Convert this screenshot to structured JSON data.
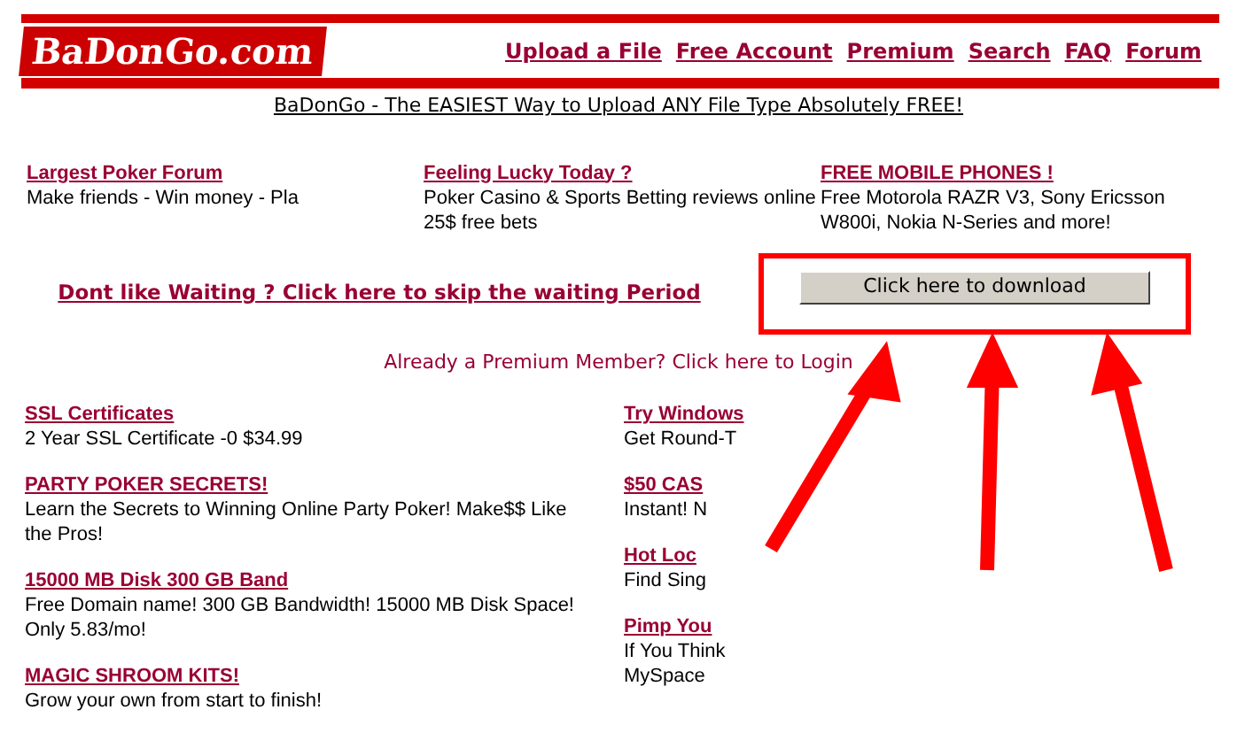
{
  "header": {
    "logo": "BaDonGo.com",
    "nav": [
      "Upload a File",
      "Free Account",
      "Premium",
      "Search",
      "FAQ",
      "Forum"
    ]
  },
  "tagline": "BaDonGo - The EASIEST Way to Upload ANY File Type Absolutely FREE!",
  "top_ads": [
    {
      "title": "Largest Poker Forum",
      "text": "Make friends - Win money - Pla"
    },
    {
      "title": "Feeling Lucky Today ?",
      "text": "Poker Casino & Sports Betting reviews online 25$ free bets"
    },
    {
      "title": "FREE MOBILE PHONES !",
      "text": "Free Motorola RAZR V3, Sony Ericsson W800i, Nokia N-Series and more!"
    }
  ],
  "skip_link": "Dont like Waiting ? Click here to skip the waiting Period",
  "download_button": "Click here to download",
  "login_link": "Already a Premium Member? Click here to Login",
  "left_ads": [
    {
      "title": "SSL Certificates",
      "text": "2 Year SSL Certificate -0 $34.99"
    },
    {
      "title": "PARTY POKER SECRETS!",
      "text": "Learn the Secrets to Winning Online Party Poker! Make$$ Like the Pros!"
    },
    {
      "title": "15000 MB Disk 300 GB Band",
      "text": "Free Domain name! 300 GB Bandwidth! 15000 MB Disk Space! Only 5.83/mo!"
    },
    {
      "title": "MAGIC SHROOM KITS!",
      "text": "Grow your own from start to finish!"
    }
  ],
  "right_ads": [
    {
      "title": "Try Windows",
      "text": "Get Round-T"
    },
    {
      "title": "$50 CAS",
      "text": "Instant! N"
    },
    {
      "title": "Hot Loc",
      "text": "Find Sing"
    },
    {
      "title": "Pimp You",
      "text": "If You Think MySpace"
    }
  ]
}
